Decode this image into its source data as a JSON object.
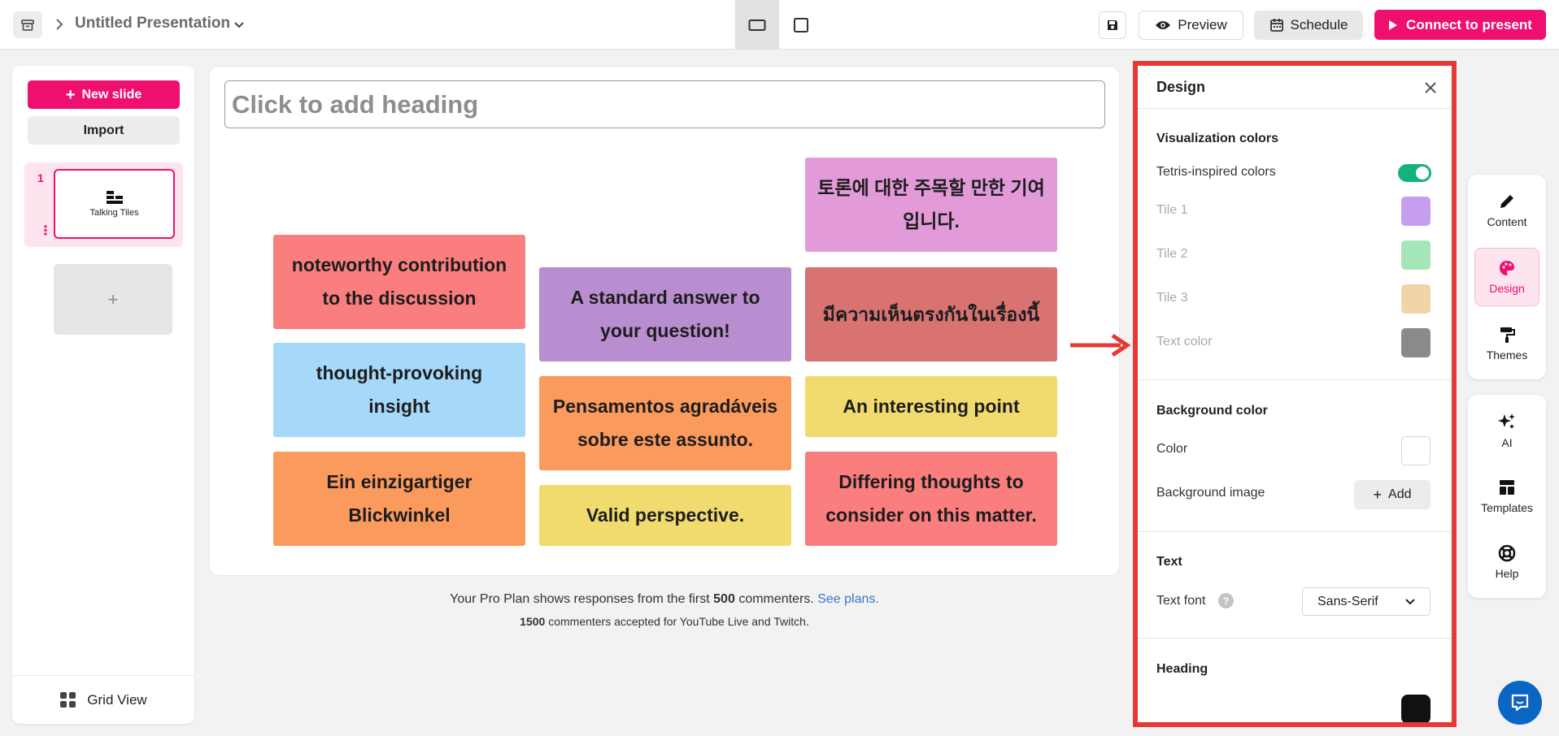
{
  "topbar": {
    "title": "Untitled Presentation",
    "preview_label": "Preview",
    "schedule_label": "Schedule",
    "connect_label": "Connect to present"
  },
  "sidebar": {
    "new_slide_label": "New slide",
    "import_label": "Import",
    "slides": [
      {
        "number": "1",
        "title": "Talking Tiles"
      }
    ],
    "add_label": "+",
    "grid_view_label": "Grid View"
  },
  "canvas": {
    "heading_placeholder": "Click to add heading",
    "tiles": [
      {
        "text": "noteworthy contribution to the discussion",
        "color": "#fb7e7e"
      },
      {
        "text": "thought-provoking insight",
        "color": "#a6d8fa"
      },
      {
        "text": "Ein einzigartiger Blickwinkel",
        "color": "#fb9a5d"
      },
      {
        "text": "A standard answer to your question!",
        "color": "#b98ed0"
      },
      {
        "text": "Pensamentos agradáveis sobre este assunto.",
        "color": "#fb9a5d"
      },
      {
        "text": "Valid perspective.",
        "color": "#f1db6f"
      },
      {
        "text": "토론에 대한 주목할 만한 기여입니다.",
        "color": "#e29ad8"
      },
      {
        "text": "มีความเห็นตรงกันในเรื่องนี้",
        "color": "#d87372"
      },
      {
        "text": "An interesting point",
        "color": "#f1db6f"
      },
      {
        "text": "Differing thoughts to consider on this matter.",
        "color": "#fb7e7e"
      }
    ]
  },
  "footer": {
    "line1_pre": "Your Pro Plan shows responses from the first",
    "line1_count": "500",
    "line1_post": "commenters.",
    "line1_link": "See plans.",
    "line2_count": "1500",
    "line2_text": "commenters accepted for YouTube Live and Twitch."
  },
  "design": {
    "title": "Design",
    "visualization_title": "Visualization colors",
    "tetris_label": "Tetris-inspired colors",
    "tetris_enabled": true,
    "tiles": [
      {
        "label": "Tile 1",
        "color": "#c69ef0"
      },
      {
        "label": "Tile 2",
        "color": "#a5e6b8"
      },
      {
        "label": "Tile 3",
        "color": "#f0d6a6"
      }
    ],
    "text_color_label": "Text color",
    "text_color": "#8a8a8a",
    "background_title": "Background color",
    "color_label": "Color",
    "background_color": "#ffffff",
    "background_image_label": "Background image",
    "add_label": "Add",
    "text_title": "Text",
    "text_font_label": "Text font",
    "text_font_value": "Sans-Serif",
    "heading_title": "Heading"
  },
  "tools": {
    "content": "Content",
    "design": "Design",
    "themes": "Themes",
    "ai": "AI",
    "templates": "Templates",
    "help": "Help"
  },
  "colors": {
    "accent": "#ee0f6f",
    "toggle_on": "#14b37d",
    "highlight": "#e53935",
    "link": "#3578c6"
  }
}
